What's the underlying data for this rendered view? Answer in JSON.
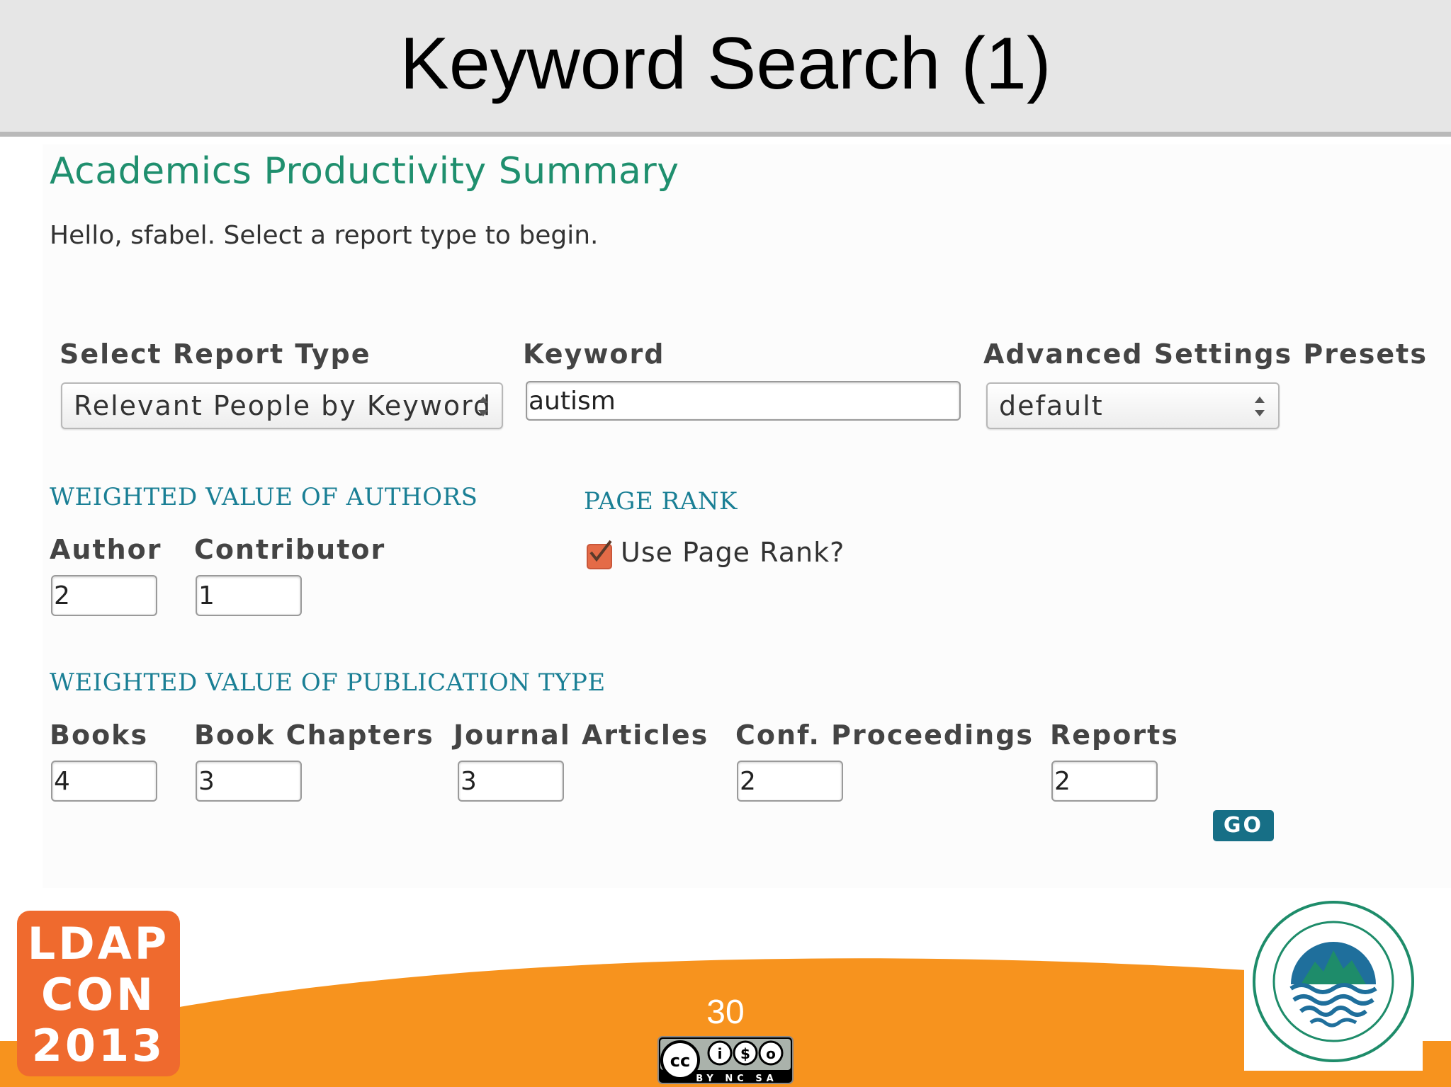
{
  "slide": {
    "title": "Keyword Search (1)",
    "page_number": "30"
  },
  "app": {
    "title": "Academics Productivity Summary",
    "greeting": "Hello, sfabel. Select a report type to begin."
  },
  "report_type": {
    "label": "Select Report Type",
    "selected": "Relevant People by Keyword"
  },
  "keyword": {
    "label": "Keyword",
    "value": "autism"
  },
  "presets": {
    "label": "Advanced Settings Presets",
    "selected": "default"
  },
  "authors_section": {
    "heading": "WEIGHTED VALUE OF AUTHORS",
    "author_label": "Author",
    "author_value": "2",
    "contributor_label": "Contributor",
    "contributor_value": "1"
  },
  "page_rank": {
    "heading": "PAGE RANK",
    "checkbox_label": "Use Page Rank?",
    "checked": true
  },
  "publication_section": {
    "heading": "WEIGHTED VALUE OF PUBLICATION TYPE",
    "books_label": "Books",
    "books_value": "4",
    "chapters_label": "Book Chapters",
    "chapters_value": "3",
    "articles_label": "Journal Articles",
    "articles_value": "3",
    "proceedings_label": "Conf. Proceedings",
    "proceedings_value": "2",
    "reports_label": "Reports",
    "reports_value": "2"
  },
  "go_button": {
    "label": "GO"
  },
  "logos": {
    "ldap_line1": "LDAP",
    "ldap_line2": "CON",
    "ldap_line3": "2013",
    "cc_icon": "cc-by-nc-sa-icon",
    "coe_icon": "college-of-education-seal-icon"
  },
  "colors": {
    "accent_green": "#1f8f6e",
    "accent_teal": "#1a7f95",
    "footer_orange": "#f7931e",
    "ldap_orange": "#ef6a2e",
    "button_teal": "#176f86",
    "checkbox_orange": "#e46b47"
  }
}
